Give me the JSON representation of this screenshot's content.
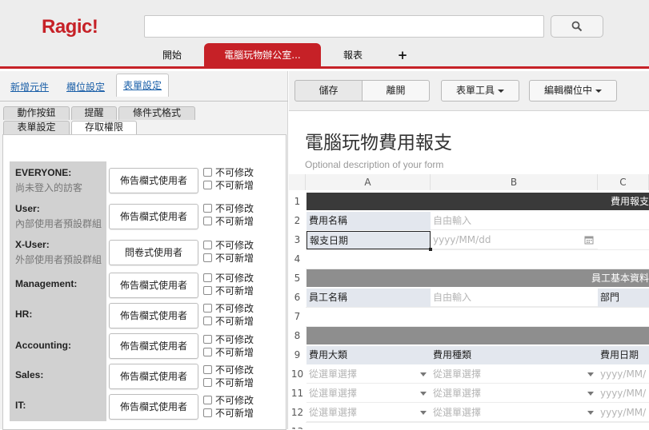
{
  "app": {
    "logo": "Ragic!"
  },
  "search": {
    "placeholder": ""
  },
  "nav": {
    "tabs": [
      "開始",
      "電腦玩物辦公室...",
      "報表",
      "+"
    ]
  },
  "left": {
    "top_links": [
      "新增元件",
      "欄位設定",
      "表單設定"
    ],
    "subtabs_row1": [
      "動作按鈕",
      "提醒",
      "條件式格式"
    ],
    "subtabs_row2": [
      "表單設定",
      "存取權限"
    ],
    "groups": [
      {
        "name": "EVERYONE",
        "desc": "尚未登入的訪客",
        "level": "佈告欄式使用者"
      },
      {
        "name": "User",
        "desc": "內部使用者預設群組",
        "level": "佈告欄式使用者"
      },
      {
        "name": "X-User",
        "desc": "外部使用者預設群組",
        "level": "問卷式使用者"
      },
      {
        "name": "Management",
        "desc": "",
        "level": "佈告欄式使用者"
      },
      {
        "name": "HR",
        "desc": "",
        "level": "佈告欄式使用者"
      },
      {
        "name": "Accounting",
        "desc": "",
        "level": "佈告欄式使用者"
      },
      {
        "name": "Sales",
        "desc": "",
        "level": "佈告欄式使用者"
      },
      {
        "name": "IT",
        "desc": "",
        "level": "佈告欄式使用者"
      }
    ],
    "chk_readonly": "不可修改",
    "chk_noadd": "不可新增"
  },
  "toolbar": {
    "save": "儲存",
    "leave": "離開",
    "form_tools": "表單工具",
    "edit_field": "編輯欄位中"
  },
  "form": {
    "title": "電腦玩物費用報支",
    "description": "Optional description of your form",
    "columns": [
      "A",
      "B",
      "C"
    ],
    "rows": [
      "1",
      "2",
      "3",
      "4",
      "5",
      "6",
      "7",
      "8",
      "9",
      "10",
      "11",
      "12",
      "13"
    ],
    "sections": {
      "row1": "費用報支",
      "row5": "員工基本資料"
    },
    "fields": {
      "expense_name": "費用名稱",
      "free_input": "自由輸入",
      "report_date": "報支日期",
      "date_placeholder": "yyyy/MM/dd",
      "employee_name": "員工名稱",
      "department": "部門",
      "expense_category": "費用大類",
      "expense_type": "費用種類",
      "expense_date": "費用日期",
      "select_from_list": "從選單選擇",
      "date_short": "yyyy/MM/"
    }
  },
  "colors": {
    "brand": "#c62127",
    "section_bg": "#3a3a3a",
    "section2_bg": "#8e8e8e",
    "label_bg": "#e3e7ee"
  }
}
